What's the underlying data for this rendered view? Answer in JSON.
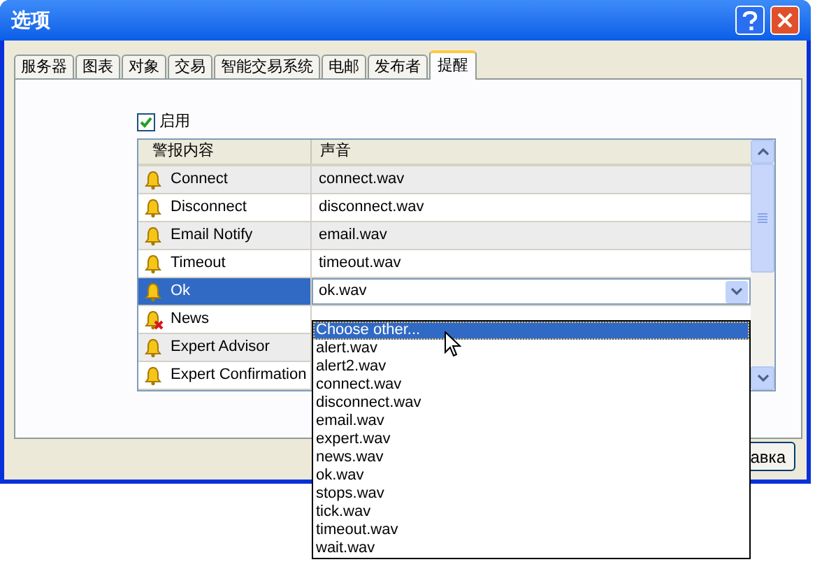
{
  "window": {
    "title": "选项"
  },
  "tabs": [
    {
      "label": "服务器",
      "selected": false
    },
    {
      "label": "图表",
      "selected": false
    },
    {
      "label": "对象",
      "selected": false
    },
    {
      "label": "交易",
      "selected": false
    },
    {
      "label": "智能交易系统",
      "selected": false
    },
    {
      "label": "电邮",
      "selected": false
    },
    {
      "label": "发布者",
      "selected": false
    },
    {
      "label": "提醒",
      "selected": true
    }
  ],
  "enable": {
    "label": "启用",
    "checked": true
  },
  "table": {
    "columns": [
      "警报内容",
      "声音"
    ],
    "rows": [
      {
        "event": "Connect",
        "sound": "connect.wav",
        "enabled": true,
        "selected": false
      },
      {
        "event": "Disconnect",
        "sound": "disconnect.wav",
        "enabled": true,
        "selected": false
      },
      {
        "event": "Email Notify",
        "sound": "email.wav",
        "enabled": true,
        "selected": false
      },
      {
        "event": "Timeout",
        "sound": "timeout.wav",
        "enabled": true,
        "selected": false
      },
      {
        "event": "Ok",
        "sound": "ok.wav",
        "enabled": true,
        "selected": true
      },
      {
        "event": "News",
        "enabled": false,
        "selected": false
      },
      {
        "event": "Expert Advisor",
        "enabled": true,
        "selected": false
      },
      {
        "event": "Expert Confirmation",
        "enabled": true,
        "selected": false
      }
    ]
  },
  "dropdown": {
    "options": [
      {
        "label": "Choose other...",
        "selected": true
      },
      {
        "label": "alert.wav",
        "selected": false
      },
      {
        "label": "alert2.wav",
        "selected": false
      },
      {
        "label": "connect.wav",
        "selected": false
      },
      {
        "label": "disconnect.wav",
        "selected": false
      },
      {
        "label": "email.wav",
        "selected": false
      },
      {
        "label": "expert.wav",
        "selected": false
      },
      {
        "label": "news.wav",
        "selected": false
      },
      {
        "label": "ok.wav",
        "selected": false
      },
      {
        "label": "stops.wav",
        "selected": false
      },
      {
        "label": "tick.wav",
        "selected": false
      },
      {
        "label": "timeout.wav",
        "selected": false
      },
      {
        "label": "wait.wav",
        "selected": false
      }
    ]
  },
  "buttons": [
    "авка"
  ]
}
